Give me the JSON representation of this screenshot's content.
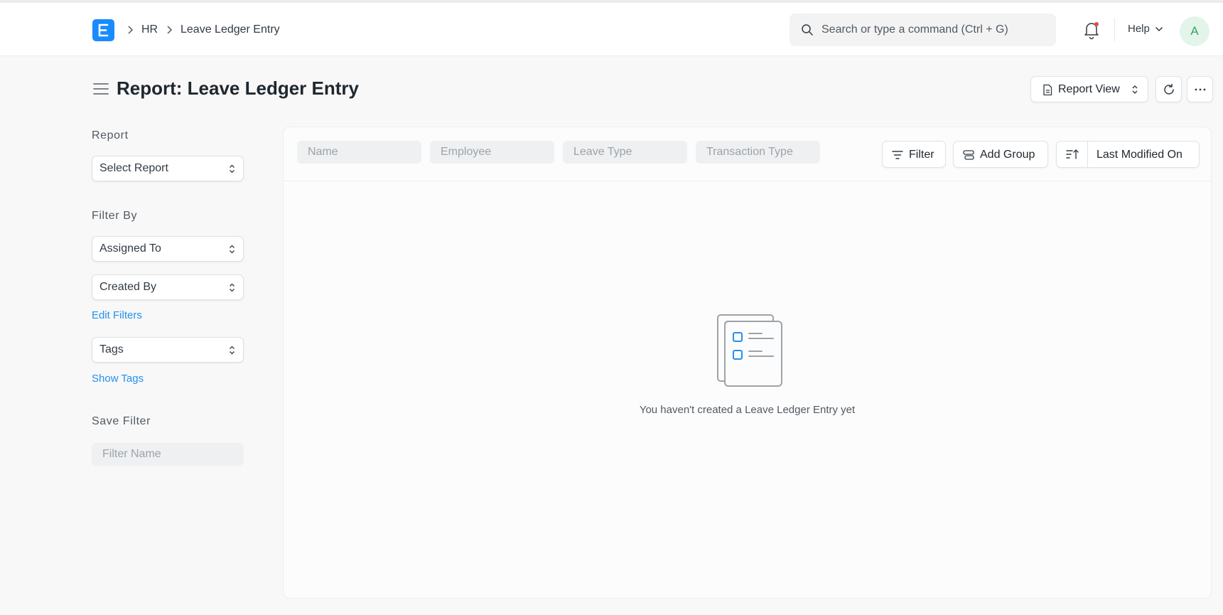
{
  "navbar": {
    "breadcrumbs": [
      "HR",
      "Leave Ledger Entry"
    ],
    "search_placeholder": "Search or type a command (Ctrl + G)",
    "help_label": "Help",
    "avatar_initial": "A"
  },
  "page": {
    "title": "Report: Leave Ledger Entry",
    "view_switcher_label": "Report View"
  },
  "sidebar": {
    "report_heading": "Report",
    "report_select_value": "Select Report",
    "filter_by_heading": "Filter By",
    "filter_selects": [
      "Assigned To",
      "Created By"
    ],
    "edit_filters_label": "Edit Filters",
    "tags_select_value": "Tags",
    "show_tags_label": "Show Tags",
    "save_filter_heading": "Save Filter",
    "filter_name_placeholder": "Filter Name"
  },
  "list": {
    "column_filters": [
      "Name",
      "Employee",
      "Leave Type",
      "Transaction Type"
    ],
    "filter_button_label": "Filter",
    "add_group_label": "Add Group",
    "sort_field_label": "Last Modified On",
    "empty_message": "You haven't created a Leave Ledger Entry yet"
  },
  "colors": {
    "brand": "#1a8bff",
    "link": "#2490ef",
    "notification_dot": "#e24c4c",
    "avatar_bg": "#e3f5ea",
    "avatar_text": "#3aa15d"
  },
  "icons": [
    "app-logo-icon",
    "chevron-right-icon",
    "search-icon",
    "bell-icon",
    "chevron-down-icon",
    "menu-icon",
    "document-icon",
    "updown-icon",
    "reload-icon",
    "more-icon",
    "filter-icon",
    "group-icon",
    "sort-ascending-icon",
    "empty-list-icon"
  ]
}
